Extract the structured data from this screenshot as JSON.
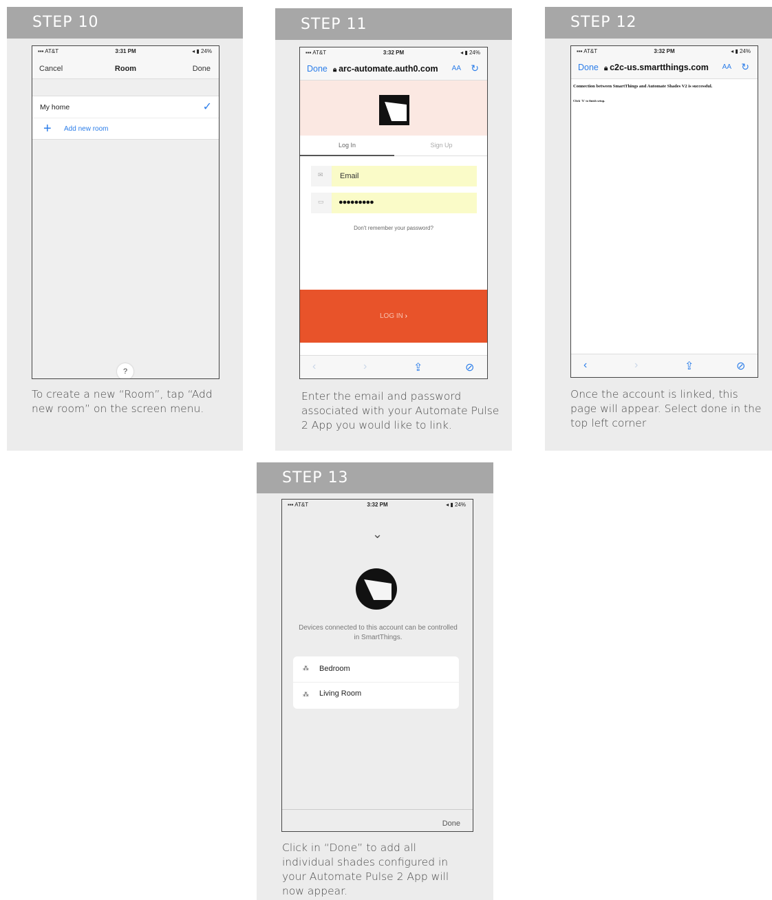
{
  "steps": {
    "s10": {
      "title": "STEP 10",
      "status": {
        "carrier": "AT&T",
        "time": "3:31 PM",
        "battery": "24%"
      },
      "nav": {
        "cancel": "Cancel",
        "title": "Room",
        "done": "Done"
      },
      "list": {
        "my_home": "My home",
        "add_room": "Add new room"
      },
      "help": "?",
      "caption": "To create a new “Room”, tap “Add new room” on the screen menu."
    },
    "s11": {
      "title": "STEP 11",
      "status": {
        "carrier": "AT&T",
        "time": "3:32 PM",
        "battery": "24%"
      },
      "url": {
        "done": "Done",
        "text": "arc-automate.auth0.com",
        "aa": "AA"
      },
      "tabs": {
        "login": "Log In",
        "signup": "Sign Up"
      },
      "email_placeholder": "Email",
      "password_value": "●●●●●●●●●",
      "forgot": "Don't remember your password?",
      "login_button": "LOG IN",
      "caption": "Enter the email and password associated with your Automate Pulse 2 App you would like to link."
    },
    "s12": {
      "title": "STEP 12",
      "status": {
        "carrier": "AT&T",
        "time": "3:32 PM",
        "battery": "24%"
      },
      "url": {
        "done": "Done",
        "text": "c2c-us.smartthings.com",
        "aa": "AA"
      },
      "message": "Connection between SmartThings and Automate Shades V2 is successful.",
      "sub": "Click 'X' to finish setup.",
      "caption": "Once the account is linked, this page will appear. Select done in the top left corner"
    },
    "s13": {
      "title": "STEP 13",
      "status": {
        "carrier": "AT&T",
        "time": "3:32 PM",
        "battery": "24%"
      },
      "desc": "Devices connected to this account can be controlled in SmartThings.",
      "rooms": [
        "Bedroom",
        "Living Room"
      ],
      "done": "Done",
      "caption": "Click in “Done” to add all individual shades configured in your Automate Pulse 2 App will now appear."
    }
  },
  "colors": {
    "accent": "#2b7de9",
    "login": "#e8532a",
    "header": "#a7a7a7"
  }
}
